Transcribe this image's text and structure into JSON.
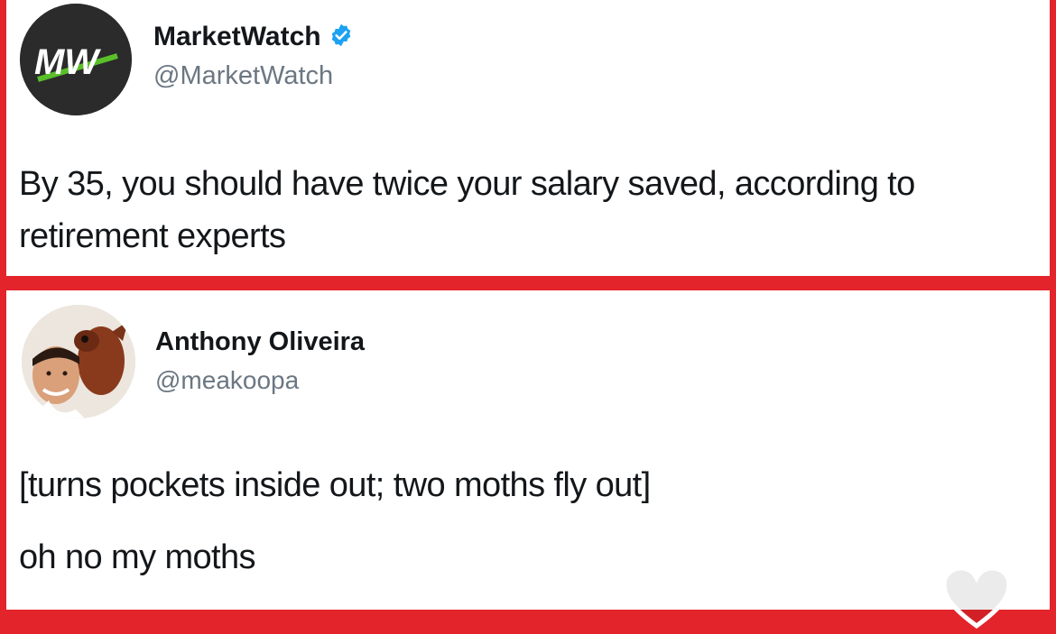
{
  "tweets": [
    {
      "avatar_text": "MW",
      "name": "MarketWatch",
      "handle": "@MarketWatch",
      "verified": true,
      "text": "By 35, you should have twice your salary saved, according to retirement experts"
    },
    {
      "name": "Anthony Oliveira",
      "handle": "@meakoopa",
      "verified": false,
      "text_lines": [
        "[turns pockets inside out; two moths fly out]",
        "oh no my moths"
      ]
    }
  ],
  "colors": {
    "frame_red": "#e3242b",
    "mw_green": "#5bbf2a",
    "verified_blue": "#1da1f2"
  },
  "icons": {
    "verified": "verified-badge-icon",
    "like": "heart-outline-icon"
  }
}
